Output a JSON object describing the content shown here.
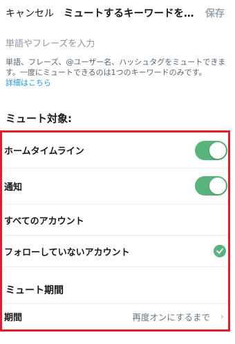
{
  "header": {
    "cancel_label": "キャンセル",
    "title": "ミュートするキーワードを…",
    "save_label": "保存"
  },
  "keyword_input": {
    "placeholder": "単語やフレーズを入力"
  },
  "help": {
    "text": "単語、フレーズ、@ユーザー名、ハッシュタグをミュートできます。一度にミュートできるのは1つのキーワードのみです。",
    "link_label": "詳細はこちら"
  },
  "mute_target": {
    "title": "ミュート対象:",
    "home_timeline": {
      "label": "ホームタイムライン",
      "enabled": true
    },
    "notifications": {
      "label": "通知",
      "enabled": true
    },
    "all_accounts": {
      "label": "すべてのアカウント",
      "selected": false
    },
    "not_following": {
      "label": "フォローしていないアカウント",
      "selected": true
    }
  },
  "mute_duration": {
    "title": "ミュート期間",
    "period_label": "期間",
    "period_value": "再度オンにするまで"
  },
  "colors": {
    "accent_green": "#58b47b",
    "link_blue": "#1d9bf0",
    "highlight_red": "#e01e2a"
  }
}
